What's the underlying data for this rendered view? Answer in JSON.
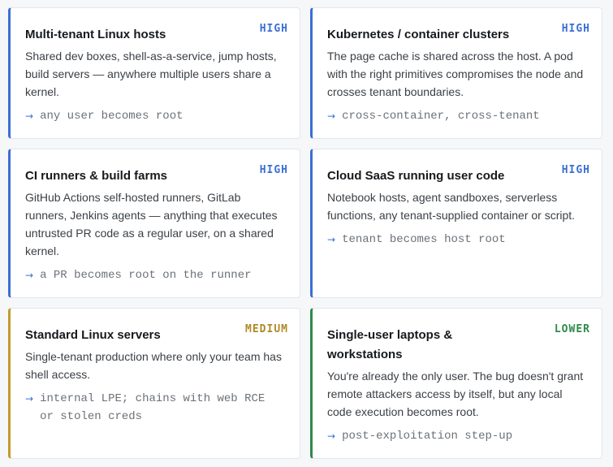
{
  "cards": [
    {
      "title": "Multi-tenant Linux hosts",
      "severity": "HIGH",
      "description": "Shared dev boxes, shell-as-a-service, jump hosts, build servers — anywhere multiple users share a kernel.",
      "impact": "any user becomes root",
      "icon": "arrow-right-icon"
    },
    {
      "title": "Kubernetes / container clusters",
      "severity": "HIGH",
      "description": "The page cache is shared across the host. A pod with the right primitives compromises the node and crosses tenant boundaries.",
      "impact": "cross-container, cross-tenant",
      "icon": "arrow-right-icon"
    },
    {
      "title": "CI runners & build farms",
      "severity": "HIGH",
      "description": "GitHub Actions self-hosted runners, GitLab runners, Jenkins agents — anything that executes untrusted PR code as a regular user, on a shared kernel.",
      "impact": "a PR becomes root on the runner",
      "icon": "arrow-right-icon"
    },
    {
      "title": "Cloud SaaS running user code",
      "severity": "HIGH",
      "description": "Notebook hosts, agent sandboxes, serverless functions, any tenant-supplied container or script.",
      "impact": "tenant becomes host root",
      "icon": "arrow-right-icon"
    },
    {
      "title": "Standard Linux servers",
      "severity": "MEDIUM",
      "description": "Single-tenant production where only your team has shell access.",
      "impact": "internal LPE; chains with web RCE or stolen creds",
      "icon": "arrow-right-icon"
    },
    {
      "title": "Single-user laptops & workstations",
      "severity": "LOWER",
      "description": "You're already the only user. The bug doesn't grant remote attackers access by itself, but any local code execution becomes root.",
      "impact": "post-exploitation step-up",
      "icon": "arrow-right-icon"
    }
  ],
  "colors": {
    "high": "#3b6fd4",
    "medium": "#c39a2e",
    "lower": "#2f8a4a",
    "arrow": "#3b6fd4"
  }
}
